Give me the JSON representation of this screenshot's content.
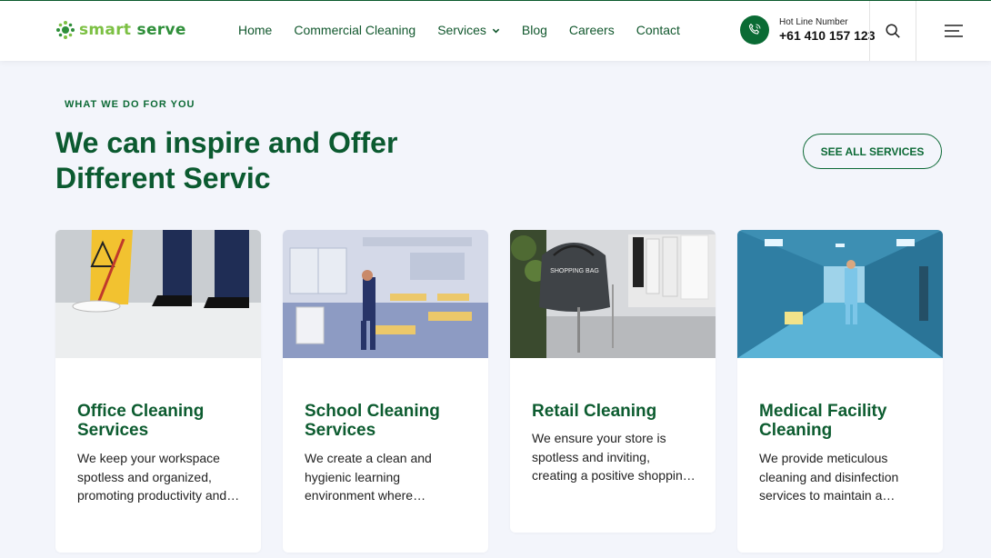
{
  "brand": {
    "logo_word1": "smart",
    "logo_word2": "serve"
  },
  "nav": {
    "home": "Home",
    "commercial": "Commercial Cleaning",
    "services": "Services",
    "blog": "Blog",
    "careers": "Careers",
    "contact": "Contact"
  },
  "hotline": {
    "label": "Hot Line Number",
    "number": "+61 410 157 123"
  },
  "section": {
    "eyebrow": "WHAT WE DO FOR YOU",
    "title_line1": "We can inspire and Offer",
    "title_line2": "Different Servic",
    "see_all": "SEE ALL SERVICES"
  },
  "cards": [
    {
      "title": "Office Cleaning Services",
      "desc": "We keep your workspace spotless and organized, promoting productivity and…"
    },
    {
      "title": "School Cleaning Services",
      "desc": "We create a clean and hygienic learning environment where student…"
    },
    {
      "title": "Retail Cleaning",
      "desc": "We ensure your store is spotless and inviting, creating a positive shoppin…"
    },
    {
      "title": "Medical Facility Cleaning",
      "desc": "We provide meticulous cleaning and disinfection services to maintain a steril…"
    }
  ],
  "images": {
    "bag_text": "SHOPPING BAG"
  },
  "colors": {
    "brand_green": "#0d6a36",
    "logo_light": "#7cc043",
    "page_bg": "#f3f5fb"
  },
  "icons": {
    "phone": "phone-icon",
    "search": "search-icon",
    "menu": "hamburger-menu-icon",
    "dropdown": "chevron-down-icon"
  }
}
